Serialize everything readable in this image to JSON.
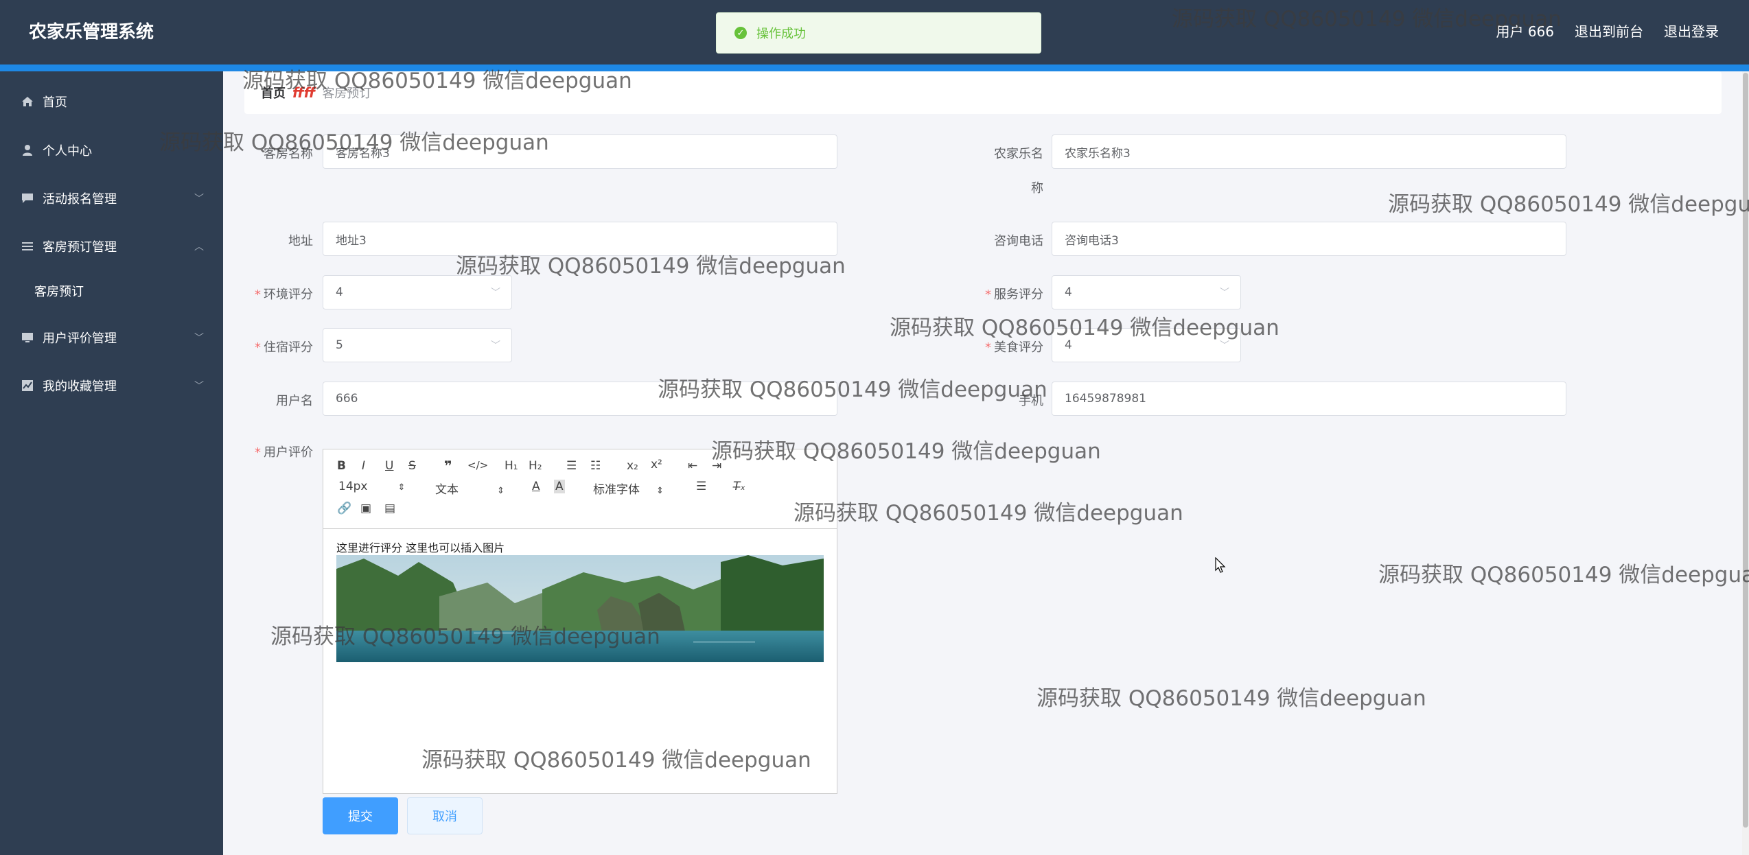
{
  "header": {
    "title": "农家乐管理系统",
    "user_label": "用户 666",
    "to_front_label": "退出到前台",
    "logout_label": "退出登录"
  },
  "toast": {
    "text": "操作成功"
  },
  "sidebar": {
    "items": [
      {
        "label": "首页",
        "icon": "home-icon"
      },
      {
        "label": "个人中心",
        "icon": "user-icon"
      },
      {
        "label": "活动报名管理",
        "icon": "chat-icon"
      },
      {
        "label": "客房预订管理",
        "icon": "list-icon",
        "expanded": true,
        "children": [
          {
            "label": "客房预订"
          }
        ]
      },
      {
        "label": "用户评价管理",
        "icon": "monitor-icon"
      },
      {
        "label": "我的收藏管理",
        "icon": "chart-icon"
      }
    ]
  },
  "breadcrumb": {
    "home": "首页",
    "separator": "ffff",
    "current": "客房预订"
  },
  "form": {
    "room_name": {
      "label": "客房名称",
      "value": "客房名称3"
    },
    "farm_name": {
      "label": "农家乐名",
      "label2": "称",
      "value": "农家乐名称3"
    },
    "address": {
      "label": "地址",
      "value": "地址3"
    },
    "phone": {
      "label": "咨询电话",
      "value": "咨询电话3"
    },
    "env_score": {
      "label": "环境评分",
      "value": "4"
    },
    "service_score": {
      "label": "服务评分",
      "value": "4"
    },
    "stay_score": {
      "label": "住宿评分",
      "value": "5"
    },
    "food_score": {
      "label": "美食评分",
      "value": "4"
    },
    "username": {
      "label": "用户名",
      "value": "666"
    },
    "mobile": {
      "label": "手机",
      "value": "16459878981"
    },
    "review": {
      "label": "用户评价",
      "text": "这里进行评分  这里也可以插入图片"
    }
  },
  "editor_toolbar": {
    "font_size": "14px",
    "text_style": "文本",
    "font_family": "标准字体"
  },
  "buttons": {
    "submit": "提交",
    "cancel": "取消"
  },
  "watermark": "源码获取 QQ86050149 微信deepguan",
  "colors": {
    "header_bg": "#2f3e52",
    "accent": "#409eff",
    "success": "#67c23a"
  }
}
